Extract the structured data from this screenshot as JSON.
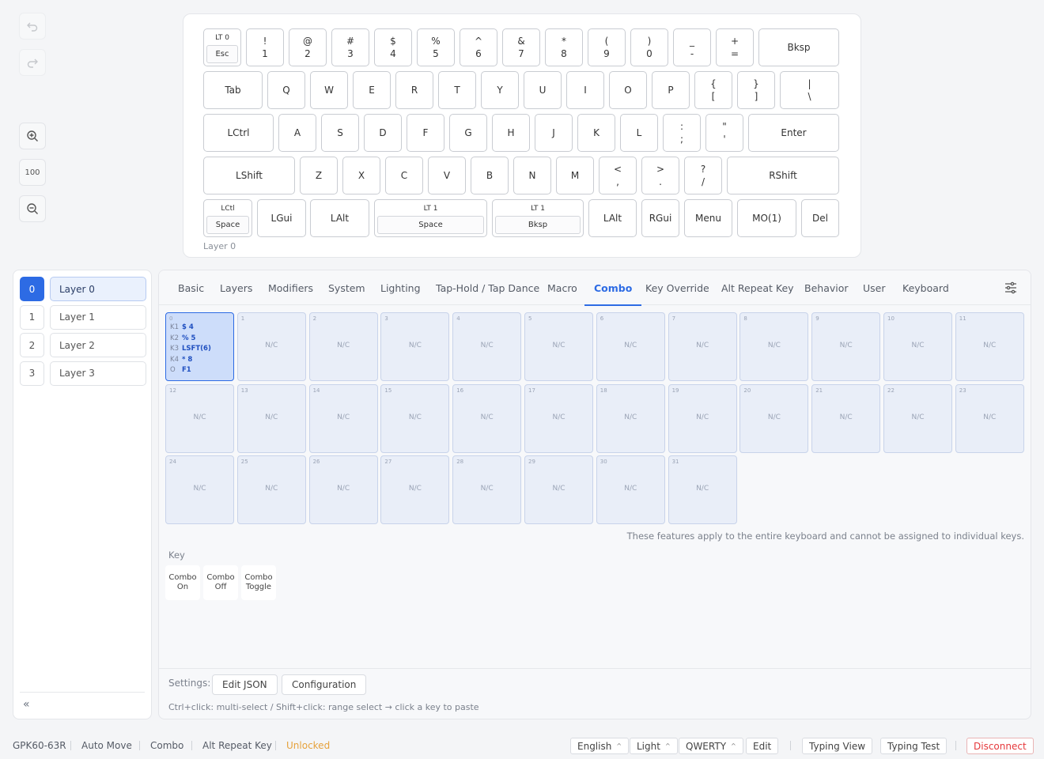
{
  "toolbar": {
    "undo_icon": "undo-icon",
    "redo_icon": "redo-icon",
    "zoom_in_icon": "zoom-in-icon",
    "zoom_level": "100",
    "zoom_out_icon": "zoom-out-icon"
  },
  "keyboard": {
    "caption": "Layer 0",
    "keys": [
      {
        "type": "split",
        "label": "LT 0",
        "inner": "Esc"
      },
      {
        "top": "!",
        "bottom": "1"
      },
      {
        "top": "@",
        "bottom": "2"
      },
      {
        "top": "#",
        "bottom": "3"
      },
      {
        "top": "$",
        "bottom": "4"
      },
      {
        "top": "%",
        "bottom": "5"
      },
      {
        "top": "^",
        "bottom": "6"
      },
      {
        "top": "&",
        "bottom": "7"
      },
      {
        "top": "*",
        "bottom": "8"
      },
      {
        "top": "(",
        "bottom": "9"
      },
      {
        "top": ")",
        "bottom": "0"
      },
      {
        "top": "_",
        "bottom": "-"
      },
      {
        "top": "+",
        "bottom": "="
      },
      {
        "main": "Bksp"
      },
      {
        "main": "Tab"
      },
      {
        "main": "Q"
      },
      {
        "main": "W"
      },
      {
        "main": "E"
      },
      {
        "main": "R"
      },
      {
        "main": "T"
      },
      {
        "main": "Y"
      },
      {
        "main": "U"
      },
      {
        "main": "I"
      },
      {
        "main": "O"
      },
      {
        "main": "P"
      },
      {
        "top": "{",
        "bottom": "["
      },
      {
        "top": "}",
        "bottom": "]"
      },
      {
        "top": "|",
        "bottom": "\\"
      },
      {
        "main": "LCtrl"
      },
      {
        "main": "A"
      },
      {
        "main": "S"
      },
      {
        "main": "D"
      },
      {
        "main": "F"
      },
      {
        "main": "G"
      },
      {
        "main": "H"
      },
      {
        "main": "J"
      },
      {
        "main": "K"
      },
      {
        "main": "L"
      },
      {
        "top": ":",
        "bottom": ";"
      },
      {
        "top": "\"",
        "bottom": "'"
      },
      {
        "main": "Enter"
      },
      {
        "main": "LShift"
      },
      {
        "main": "Z"
      },
      {
        "main": "X"
      },
      {
        "main": "C"
      },
      {
        "main": "V"
      },
      {
        "main": "B"
      },
      {
        "main": "N"
      },
      {
        "main": "M"
      },
      {
        "top": "<",
        "bottom": ","
      },
      {
        "top": ">",
        "bottom": "."
      },
      {
        "top": "?",
        "bottom": "/"
      },
      {
        "main": "RShift"
      },
      {
        "type": "split",
        "label": "LCtl",
        "inner": "Space"
      },
      {
        "main": "LGui"
      },
      {
        "main": "LAlt"
      },
      {
        "type": "split",
        "label": "LT 1",
        "inner": "Space"
      },
      {
        "type": "split",
        "label": "LT 1",
        "inner": "Bksp"
      },
      {
        "main": "LAlt"
      },
      {
        "main": "RGui"
      },
      {
        "main": "Menu"
      },
      {
        "main": "MO(1)"
      },
      {
        "main": "Del"
      }
    ]
  },
  "layers": {
    "items": [
      {
        "num": "0",
        "name": "Layer 0",
        "active": true
      },
      {
        "num": "1",
        "name": "Layer 1",
        "active": false
      },
      {
        "num": "2",
        "name": "Layer 2",
        "active": false
      },
      {
        "num": "3",
        "name": "Layer 3",
        "active": false
      }
    ],
    "collapse": "«"
  },
  "tabs": [
    "Basic",
    "Layers",
    "Modifiers",
    "System",
    "Lighting",
    "Tap-Hold / Tap Dance",
    "Macro",
    "Combo",
    "Key Override",
    "Alt Repeat Key",
    "Behavior",
    "User",
    "Keyboard"
  ],
  "active_tab": "Combo",
  "combos": {
    "first": {
      "index": "0",
      "lines": [
        {
          "k": "K1",
          "v": "$ 4"
        },
        {
          "k": "K2",
          "v": "% 5"
        },
        {
          "k": "K3",
          "v": "LSFT(6)"
        },
        {
          "k": "K4",
          "v": "* 8"
        },
        {
          "k": "O",
          "v": "F1"
        }
      ]
    },
    "empty_label": "N/C",
    "count": 32
  },
  "note": "These features apply to the entire keyboard and cannot be assigned to individual keys.",
  "key_section": {
    "label": "Key",
    "buttons": [
      {
        "l1": "Combo",
        "l2": "On"
      },
      {
        "l1": "Combo",
        "l2": "Off"
      },
      {
        "l1": "Combo",
        "l2": "Toggle"
      }
    ]
  },
  "settings": {
    "label": "Settings:",
    "edit_json": "Edit JSON",
    "configuration": "Configuration",
    "hint": "Ctrl+click: multi-select / Shift+click: range select → click a key to paste"
  },
  "status": {
    "device": "GPK60-63R",
    "auto_move": "Auto Move",
    "combo": "Combo",
    "alt_repeat": "Alt Repeat Key",
    "lock_state": "Unlocked",
    "language": "English",
    "theme": "Light",
    "layout": "QWERTY",
    "edit": "Edit",
    "typing_view": "Typing View",
    "typing_test": "Typing Test",
    "disconnect": "Disconnect",
    "lock_color": "#e6a23c",
    "disconnect_color": "#e5383b"
  }
}
